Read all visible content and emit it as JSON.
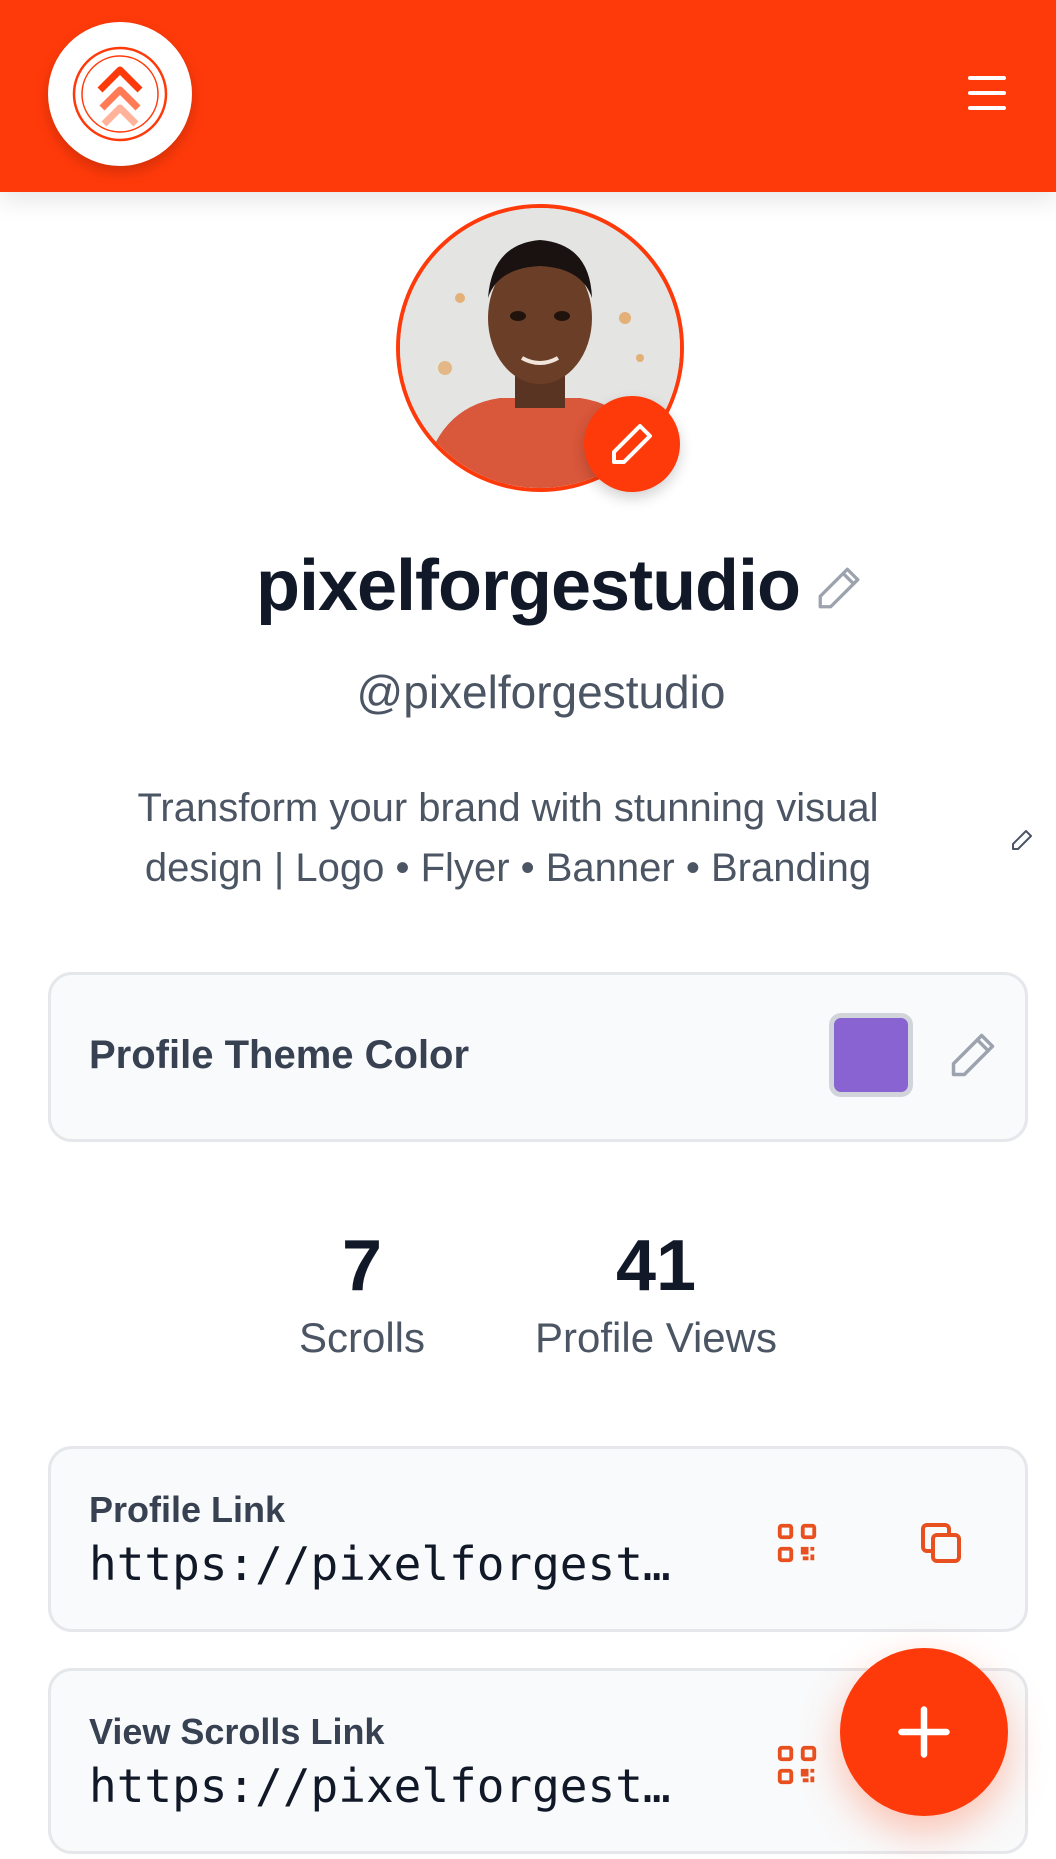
{
  "header": {
    "logo_icon": "double-chevron-up-icon",
    "menu_icon": "hamburger-menu-icon",
    "brand_color": "#ff3a0a"
  },
  "profile": {
    "avatar_icon": "user-avatar",
    "display_name": "pixelforgestudio",
    "handle": "@pixelforgestudio",
    "bio": "Transform your brand with stunning visual design | Logo • Flyer • Banner • Branding"
  },
  "theme": {
    "label": "Profile Theme Color",
    "color": "#8a63d2"
  },
  "stats": [
    {
      "value": "7",
      "label": "Scrolls"
    },
    {
      "value": "41",
      "label": "Profile Views"
    }
  ],
  "links": [
    {
      "title": "Profile Link",
      "url": "https://pixelforgestudio.example.com/profile"
    },
    {
      "title": "View Scrolls Link",
      "url": "https://pixelforgestudio.example.com/scrolls"
    }
  ],
  "fab": {
    "icon": "plus-icon"
  }
}
